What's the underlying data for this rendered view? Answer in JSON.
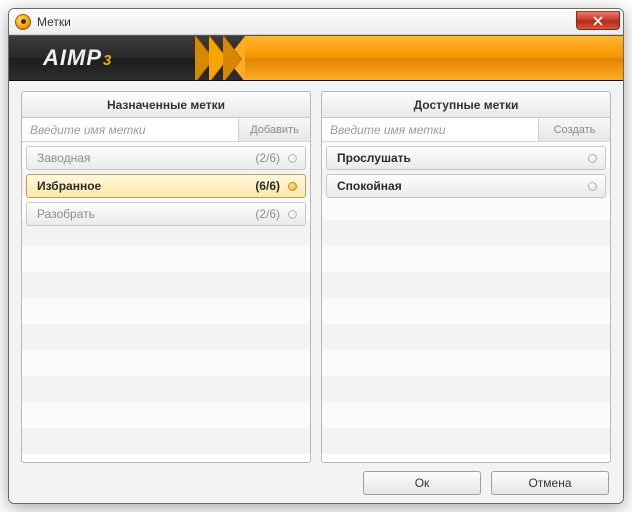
{
  "window": {
    "title": "Метки"
  },
  "brand": {
    "name": "AIMP",
    "suffix": "3"
  },
  "left": {
    "header": "Назначенные метки",
    "placeholder": "Введите имя метки",
    "add_label": "Добавить",
    "items": [
      {
        "label": "Заводная",
        "count": "(2/6)",
        "selected": false
      },
      {
        "label": "Избранное",
        "count": "(6/6)",
        "selected": true
      },
      {
        "label": "Разобрать",
        "count": "(2/6)",
        "selected": false
      }
    ]
  },
  "right": {
    "header": "Доступные метки",
    "placeholder": "Введите имя метки",
    "create_label": "Создать",
    "items": [
      {
        "label": "Прослушать"
      },
      {
        "label": "Спокойная"
      }
    ]
  },
  "footer": {
    "ok": "Ок",
    "cancel": "Отмена"
  }
}
